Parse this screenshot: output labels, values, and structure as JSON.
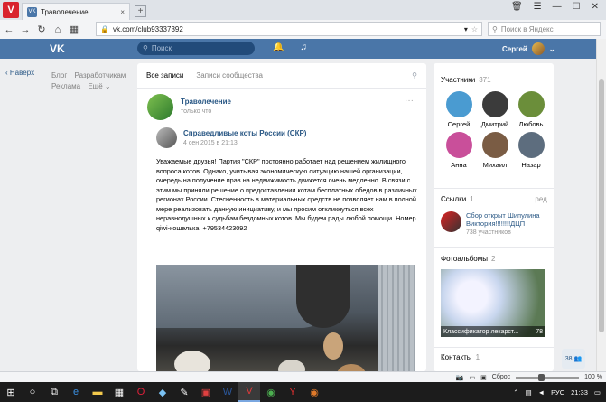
{
  "browser": {
    "logo": "V",
    "tab_title": "Траволечение",
    "tab_close": "×",
    "new_tab": "+",
    "url": "vk.com/club93337392",
    "search_placeholder": "Поиск в Яндекс",
    "zoom": "100 %",
    "reset_label": "Сброс"
  },
  "vk_header": {
    "logo": "VK",
    "search_placeholder": "Поиск",
    "user_name": "Сергей"
  },
  "left": {
    "back_label": "Наверх",
    "links": [
      "Блог",
      "Разработчикам",
      "Реклама",
      "Ещё ⌄"
    ]
  },
  "feed": {
    "tabs": [
      "Все записи",
      "Записи сообщества"
    ],
    "post": {
      "author": "Траволечение",
      "time": "только что",
      "repost": {
        "author": "Справедливые коты России (СКР)",
        "time": "4 сен 2015 в 21:13",
        "text": "Уважаемые друзья! Партия \"СКР\" постоянно работает над решением жилищного вопроса котов. Однако, учитывая экономическую ситуацию нашей организации, очередь на получение прав на недвижимость движется очень медленно. В связи с этим мы приняли решение о предоставлении котам бесплатных обедов в различных регионах России. Стесненность в материальных средств не позволяет нам в полной мере реализовать данную инициативу, и мы просим откликнуться всех неравнодушных к судьбам бездомных котов. Мы будем рады любой помощи. Номер qiwi-кошелька: +79534423092"
      }
    }
  },
  "sidebar": {
    "members": {
      "title": "Участники",
      "count": "371",
      "people": [
        {
          "name": "Сергей",
          "color": "#4a9bd1"
        },
        {
          "name": "Дмитрий",
          "color": "#3b3b3b"
        },
        {
          "name": "Любовь",
          "color": "#6b8e3a"
        },
        {
          "name": "Анна",
          "color": "#c94f9a"
        },
        {
          "name": "Михаил",
          "color": "#7a5c44"
        },
        {
          "name": "Назар",
          "color": "#5d6d7e"
        }
      ]
    },
    "links": {
      "title": "Ссылки",
      "count": "1",
      "edit": "ред.",
      "item_title": "Сбор открыт Шипулина Виктория!!!!!!!!ДЦП",
      "item_sub": "738 участников"
    },
    "albums": {
      "title": "Фотоальбомы",
      "count": "2",
      "caption": "Классификатор лекарст...",
      "caption_count": "78"
    },
    "contacts": {
      "title": "Контакты",
      "count": "1"
    }
  },
  "chat_badge": "38",
  "taskbar": {
    "lang": "РУС",
    "time": "21:33"
  }
}
